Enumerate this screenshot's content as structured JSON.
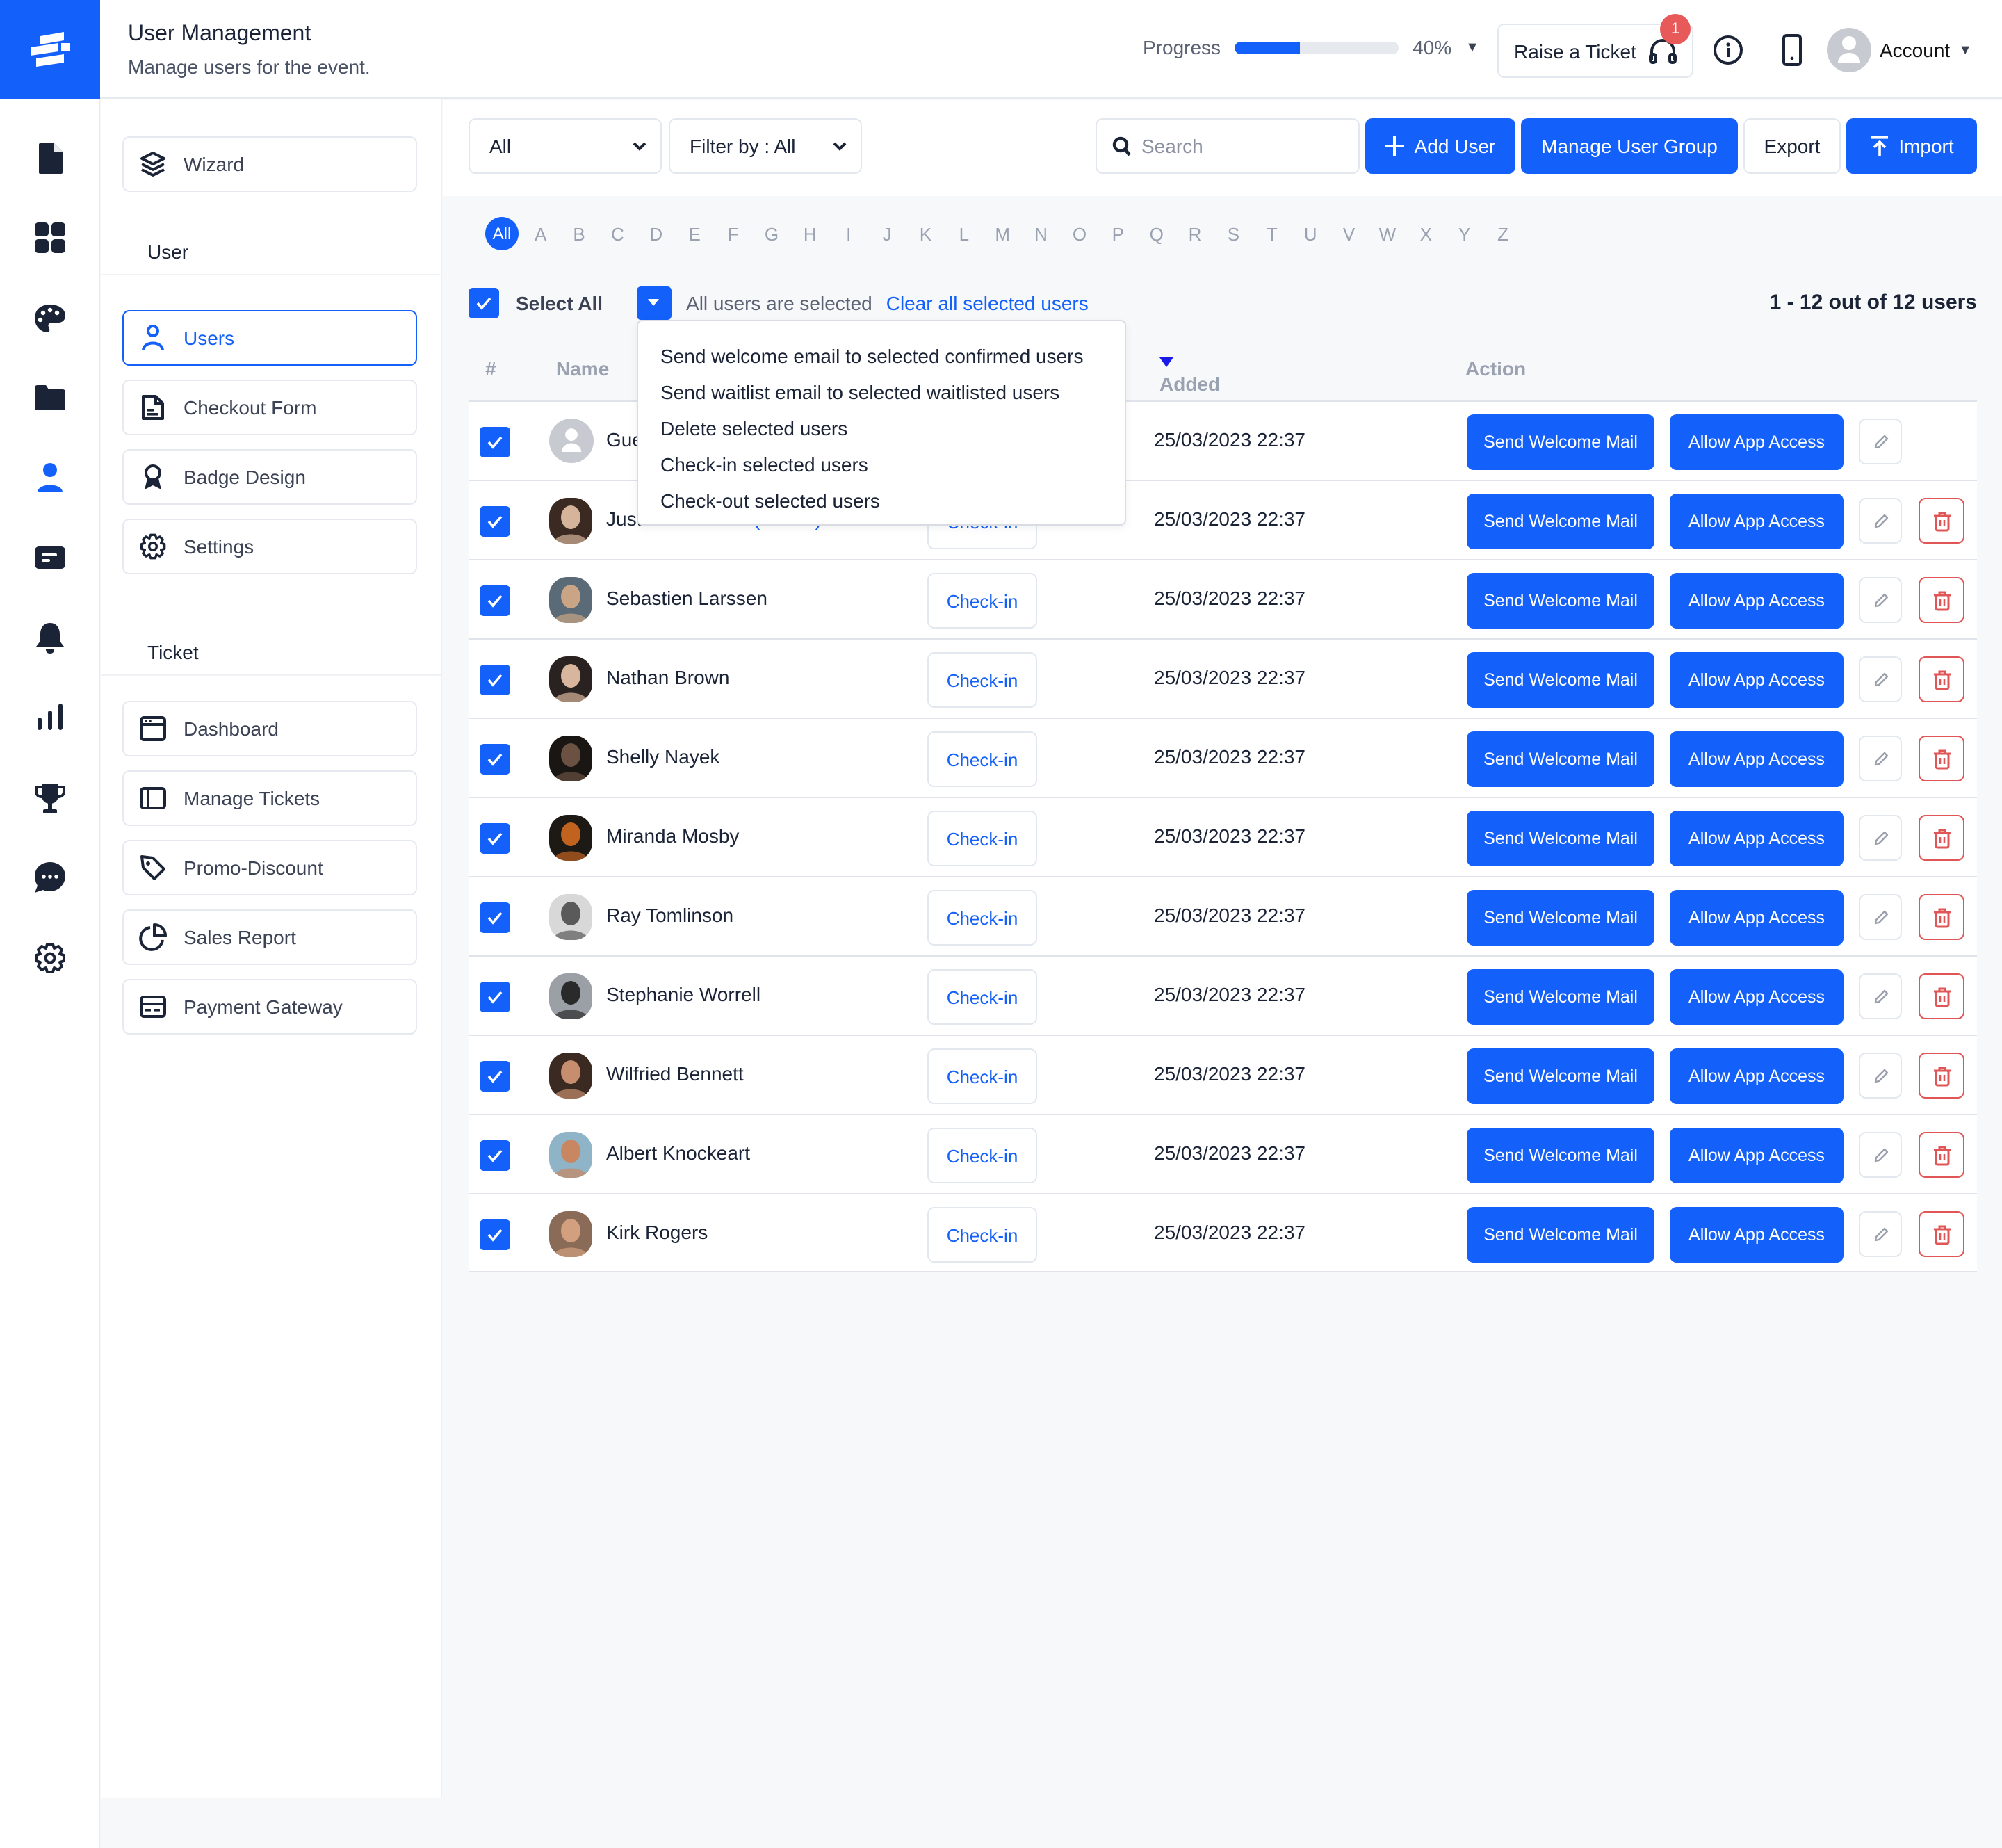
{
  "header": {
    "title": "User Management",
    "subtitle": "Manage users for the event.",
    "progress_label": "Progress",
    "progress_value": 40,
    "progress_text": "40%",
    "raise_ticket_label": "Raise a Ticket",
    "notification_count": "1",
    "account_label": "Account"
  },
  "colors": {
    "accent": "#1460fa",
    "danger": "#e05555",
    "badge": "#e85a5a"
  },
  "rail": {
    "items": [
      {
        "icon": "document-icon"
      },
      {
        "icon": "grid-icon"
      },
      {
        "icon": "palette-icon"
      },
      {
        "icon": "folder-icon"
      },
      {
        "icon": "user-icon",
        "active": true
      },
      {
        "icon": "card-icon"
      },
      {
        "icon": "bell-icon"
      },
      {
        "icon": "bar-chart-icon"
      },
      {
        "icon": "trophy-icon"
      },
      {
        "icon": "chat-icon"
      },
      {
        "icon": "gear-icon"
      }
    ]
  },
  "sidebar": {
    "wizard_label": "Wizard",
    "user_section": "User",
    "user_items": [
      {
        "label": "Users",
        "icon": "user-outline-icon",
        "active": true
      },
      {
        "label": "Checkout Form",
        "icon": "form-icon"
      },
      {
        "label": "Badge Design",
        "icon": "badge-icon"
      },
      {
        "label": "Settings",
        "icon": "settings-icon"
      }
    ],
    "ticket_section": "Ticket",
    "ticket_items": [
      {
        "label": "Dashboard",
        "icon": "browser-icon"
      },
      {
        "label": "Manage Tickets",
        "icon": "layout-icon"
      },
      {
        "label": "Promo-Discount",
        "icon": "tag-icon"
      },
      {
        "label": "Sales Report",
        "icon": "pie-chart-icon"
      },
      {
        "label": "Payment Gateway",
        "icon": "credit-card-icon"
      }
    ]
  },
  "toolbar": {
    "status_select": "All",
    "filter_select": "Filter by : All",
    "search_placeholder": "Search",
    "search_value": "",
    "add_user_label": "Add User",
    "manage_group_label": "Manage User Group",
    "export_label": "Export",
    "import_label": "Import"
  },
  "alphabet": {
    "selected": "All",
    "letters": [
      "A",
      "B",
      "C",
      "D",
      "E",
      "F",
      "G",
      "H",
      "I",
      "J",
      "K",
      "L",
      "M",
      "N",
      "O",
      "P",
      "Q",
      "R",
      "S",
      "T",
      "U",
      "V",
      "W",
      "X",
      "Y",
      "Z"
    ]
  },
  "selection": {
    "select_all_label": "Select All",
    "select_all_checked": true,
    "message": "All users are selected",
    "clear_label": "Clear all selected users",
    "count_text": "1 - 12 out of 12 users"
  },
  "bulk_menu": {
    "items": [
      "Send welcome email to selected confirmed users",
      "Send waitlist email to selected waitlisted users",
      "Delete selected users",
      "Check-in selected users",
      "Check-out selected users"
    ]
  },
  "table": {
    "columns": {
      "index": "#",
      "name": "Name",
      "added_on": "Added on",
      "action": "Action"
    },
    "sort": {
      "column": "added_on",
      "direction": "desc"
    },
    "action_labels": {
      "checkin": "Check-in",
      "welcome": "Send Welcome Mail",
      "app_access": "Allow App Access"
    },
    "rows": [
      {
        "name": "Guest",
        "role": "",
        "checked": true,
        "avatar": "placeholder",
        "added_on": "25/03/2023 22:37",
        "deletable": false,
        "checkin_visible": false
      },
      {
        "name": "Justin Goodman",
        "role": "(Admin)",
        "checked": true,
        "avatar": "photo",
        "added_on": "25/03/2023 22:37",
        "deletable": true,
        "checkin_visible": true
      },
      {
        "name": "Sebastien Larssen",
        "role": "",
        "checked": true,
        "avatar": "photo",
        "added_on": "25/03/2023 22:37",
        "deletable": true,
        "checkin_visible": true
      },
      {
        "name": "Nathan Brown",
        "role": "",
        "checked": true,
        "avatar": "photo",
        "added_on": "25/03/2023 22:37",
        "deletable": true,
        "checkin_visible": true
      },
      {
        "name": "Shelly Nayek",
        "role": "",
        "checked": true,
        "avatar": "photo",
        "added_on": "25/03/2023 22:37",
        "deletable": true,
        "checkin_visible": true
      },
      {
        "name": "Miranda Mosby",
        "role": "",
        "checked": true,
        "avatar": "photo",
        "added_on": "25/03/2023 22:37",
        "deletable": true,
        "checkin_visible": true
      },
      {
        "name": "Ray Tomlinson",
        "role": "",
        "checked": true,
        "avatar": "photo",
        "added_on": "25/03/2023 22:37",
        "deletable": true,
        "checkin_visible": true
      },
      {
        "name": "Stephanie Worrell",
        "role": "",
        "checked": true,
        "avatar": "photo",
        "added_on": "25/03/2023 22:37",
        "deletable": true,
        "checkin_visible": true
      },
      {
        "name": "Wilfried Bennett",
        "role": "",
        "checked": true,
        "avatar": "photo",
        "added_on": "25/03/2023 22:37",
        "deletable": true,
        "checkin_visible": true
      },
      {
        "name": "Albert Knockeart",
        "role": "",
        "checked": true,
        "avatar": "photo",
        "added_on": "25/03/2023 22:37",
        "deletable": true,
        "checkin_visible": true
      },
      {
        "name": "Kirk Rogers",
        "role": "",
        "checked": true,
        "avatar": "photo",
        "added_on": "25/03/2023 22:37",
        "deletable": true,
        "checkin_visible": true
      }
    ]
  }
}
